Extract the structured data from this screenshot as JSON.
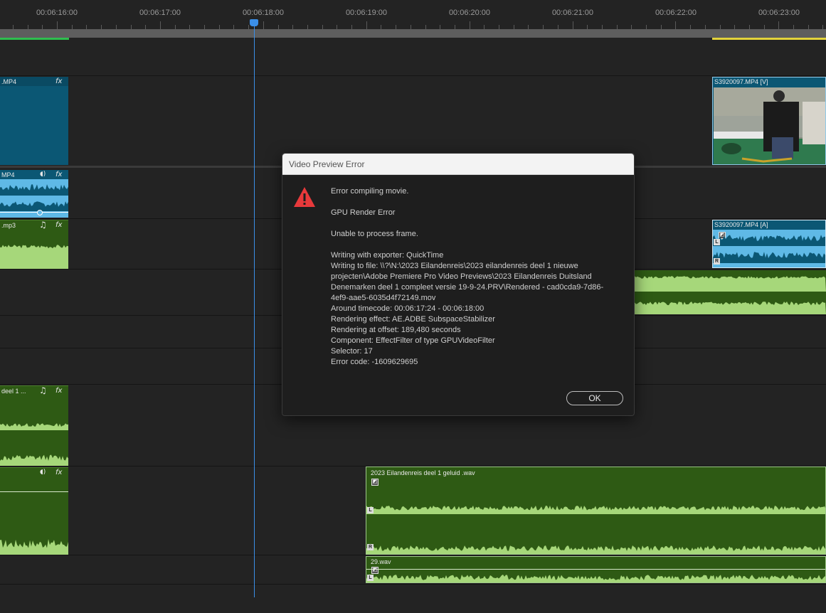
{
  "ruler": {
    "ticks": [
      "00:06:16:00",
      "00:06:17:00",
      "00:06:18:00",
      "00:06:19:00",
      "00:06:20:00",
      "00:06:21:00",
      "00:06:22:00",
      "00:06:23:00"
    ]
  },
  "clips": {
    "v1_left_label": ".MP4",
    "a1_left_label": "MP4",
    "a2_left_label": ".mp3",
    "a4_left_label": "deel 1 ...",
    "v1_right_label": "S3920097.MP4 [V]",
    "a1_right_label": "S3920097.MP4 [A]",
    "a5_right_label": "2023 Eilandenreis deel 1 geluid .wav",
    "a6_right_label": "29.wav",
    "fx_label": "fx",
    "left_channel": "L",
    "right_channel": "R"
  },
  "icons": {
    "fx": "fx-badge-icon",
    "music": "music-note-icon",
    "speaker": "speaker-icon",
    "warning": "warning-triangle-icon"
  },
  "colors": {
    "video_clip": "#0b5774",
    "audio_clip_blue": "#5fb9e6",
    "audio_clip_green": "#2e5a14",
    "waveform_green": "#a6d77a",
    "playhead": "#3b8fe8",
    "work_area_green": "#2fbf4f",
    "work_area_yellow": "#e3d33b",
    "warning_red": "#e8393b"
  },
  "dialog": {
    "title": "Video Preview Error",
    "line1": "Error compiling movie.",
    "line2": "GPU Render Error",
    "line3": "Unable to process frame.",
    "details": [
      "Writing with exporter: QuickTime",
      "Writing to file: \\\\?\\N:\\2023 Eilandenreis\\2023 eilandenreis deel 1 nieuwe",
      "projecten\\Adobe Premiere Pro Video Previews\\2023  Eilandenreis Duitsland",
      "Denemarken deel 1 compleet versie 19-9-24.PRV\\Rendered - cad0cda9-7d86-",
      "4ef9-aae5-6035d4f72149.mov",
      "Around timecode: 00:06:17:24 - 00:06:18:00",
      "Rendering effect: AE.ADBE SubspaceStabilizer",
      "Rendering at offset: 189,480 seconds",
      "Component: EffectFilter of type GPUVideoFilter",
      "Selector: 17",
      "Error code: -1609629695"
    ],
    "ok_label": "OK"
  }
}
